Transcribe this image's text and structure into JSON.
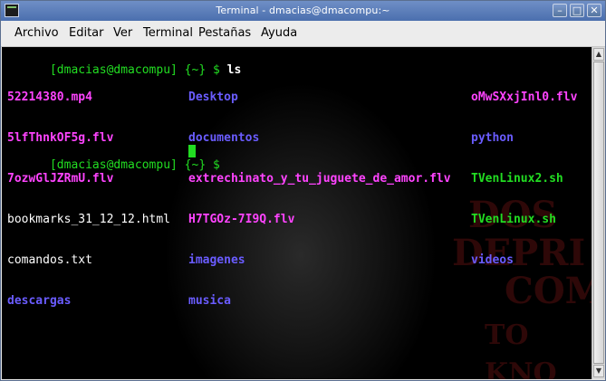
{
  "window": {
    "title": "Terminal - dmacias@dmacompu:~",
    "buttons": {
      "minimize": "–",
      "maximize": "□",
      "close": "✕"
    }
  },
  "menu": {
    "items": [
      "Archivo",
      "Editar",
      "Ver",
      "Terminal",
      "Pestañas",
      "Ayuda"
    ]
  },
  "terminal": {
    "prompt": "[dmacias@dmacompu] {~} $",
    "command": "ls",
    "files": {
      "col1": [
        "52214380.mp4",
        "5lfThnkOF5g.flv",
        "7ozwGlJZRmU.flv",
        "bookmarks_31_12_12.html",
        "comandos.txt",
        "descargas"
      ],
      "col2": [
        "Desktop",
        "documentos",
        "extrechinato_y_tu_juguete_de_amor.flv",
        "H7TGOz-7I9Q.flv",
        "imagenes",
        "musica"
      ],
      "col3": [
        "oMwSXxjInl0.flv",
        "python",
        "TVenLinux2.sh",
        "TVenLinux.sh",
        "videos"
      ]
    },
    "background_text": [
      "DOS",
      "DEPRI",
      "COM",
      "TO KNO"
    ],
    "colors": {
      "prompt": "#22dd22",
      "command": "#ffffff",
      "video": "#ff44ff",
      "directory": "#6a5cff",
      "script": "#22dd22",
      "plain": "#ffffff"
    }
  }
}
